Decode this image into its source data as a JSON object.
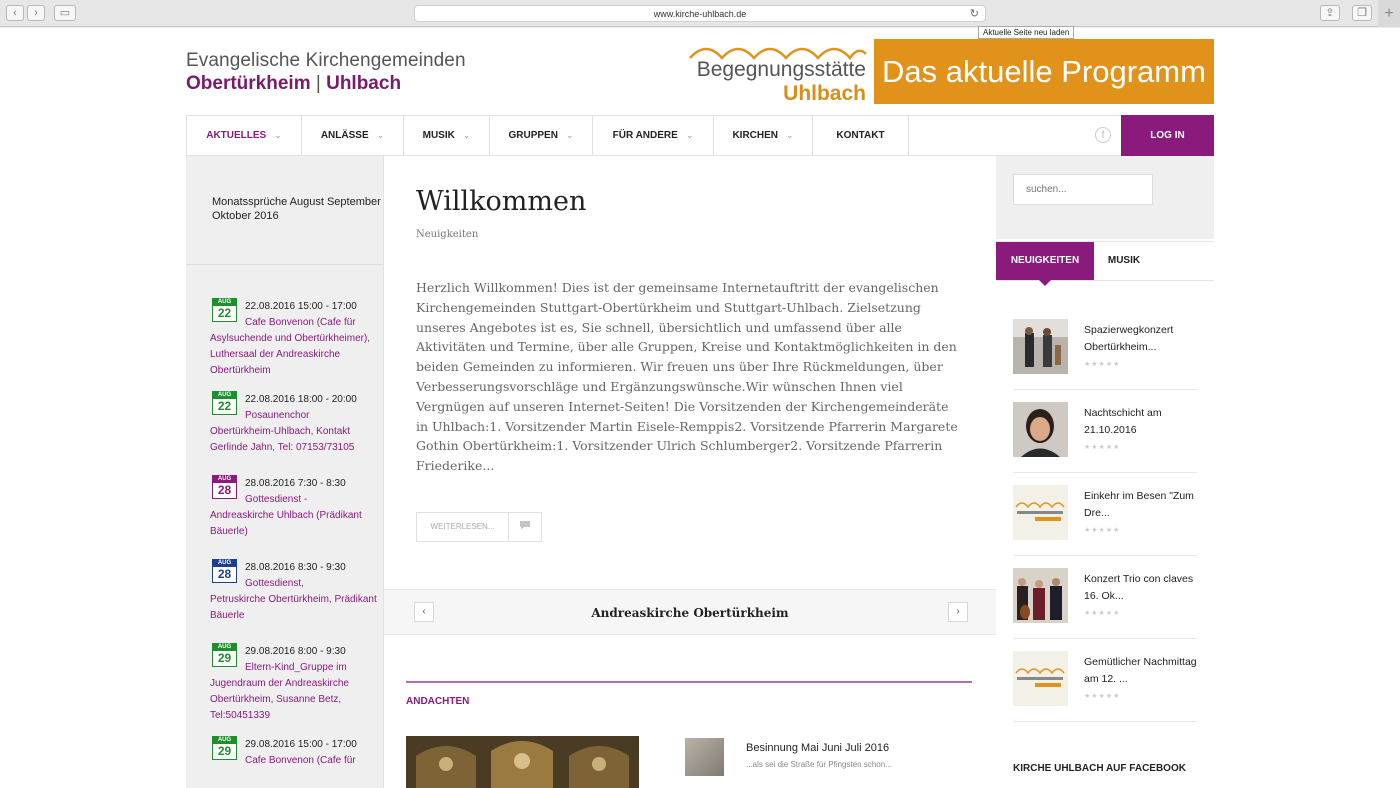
{
  "browser": {
    "url": "www.kirche-uhlbach.de",
    "tooltip": "Aktuelle Seite neu laden"
  },
  "brand": {
    "line1": "Evangelische Kirchengemeinden",
    "line2_a": "Obertürkheim",
    "line2_sep": "|",
    "line2_b": "Uhlbach"
  },
  "logo": {
    "word1": "Begegnungsstätte",
    "word2": "Uhlbach",
    "colors": {
      "orange": "#e1921b",
      "purple": "#8b1a7d"
    }
  },
  "banner": {
    "text": "Das aktuelle Programm"
  },
  "nav": {
    "items": [
      {
        "label": "AKTUELLES",
        "chevron": "⌄"
      },
      {
        "label": "ANLÄSSE",
        "chevron": "⌄"
      },
      {
        "label": "MUSIK",
        "chevron": "⌄"
      },
      {
        "label": "GRUPPEN",
        "chevron": "⌄"
      },
      {
        "label": "FÜR ANDERE",
        "chevron": "⌄"
      },
      {
        "label": "KIRCHEN",
        "chevron": "⌄"
      },
      {
        "label": "KONTAKT",
        "chevron": ""
      }
    ],
    "facebook_glyph": "f",
    "login": "LOG IN"
  },
  "left": {
    "heading": "Monatssprüche August September Oktober 2016",
    "events": [
      {
        "month": "AUG",
        "day": "22",
        "color": "#1f8f2e",
        "date": "22.08.2016 15:00 - 17:00",
        "title": "Cafe Bonvenon (Cafe für",
        "cont": "Asylsuchende und Obertürkheimer), Luthersaal der Andreaskirche Obertürkheim"
      },
      {
        "month": "AUG",
        "day": "22",
        "color": "#1f8f2e",
        "date": "22.08.2016 18:00 - 20:00",
        "title": "Posaunenchor",
        "cont": "Obertürkheim-Uhlbach, Kontakt Gerlinde Jahn, Tel: 07153/73105"
      },
      {
        "month": "AUG",
        "day": "28",
        "color": "#8b1a7d",
        "date": "28.08.2016 7:30 - 8:30",
        "title": "Gottesdienst -",
        "cont": "Andreaskirche Uhlbach (Prädikant Bäuerle)"
      },
      {
        "month": "AUG",
        "day": "28",
        "color": "#1c3f94",
        "date": "28.08.2016 8:30 - 9:30",
        "title": "Gottesdienst,",
        "cont": "Petruskirche Obertürkheim, Prädikant Bäuerle"
      },
      {
        "month": "AUG",
        "day": "29",
        "color": "#1f8f2e",
        "date": "29.08.2016 8:00 - 9:30",
        "title": "Eltern-Kind_Gruppe im",
        "cont": "Jugendraum der Andreaskirche Obertürkheim, Susanne Betz, Tel:50451339"
      },
      {
        "month": "AUG",
        "day": "29",
        "color": "#1f8f2e",
        "date": "29.08.2016 15:00 - 17:00",
        "title": "Cafe Bonvenon (Cafe für",
        "cont": ""
      }
    ]
  },
  "post": {
    "title": "Willkommen",
    "category": "Neuigkeiten",
    "body": "Herzlich Willkommen! Dies ist der gemeinsame Internetauftritt der evangelischen Kirchengemeinden Stuttgart-Obertürkheim und Stuttgart-Uhlbach. Zielsetzung unseres Angebotes ist es, Sie schnell, übersichtlich und umfassend über alle Aktivitäten und Termine, über alle Gruppen, Kreise und Kontaktmöglichkeiten in den beiden Gemeinden zu informieren. Wir freuen uns über Ihre Rückmeldungen, über Verbesserungsvorschläge und Ergänzungswünsche.Wir wünschen Ihnen viel Vergnügen auf unseren Internet-Seiten! Die Vorsitzenden der Kirchengemeinderäte in Uhlbach:1. Vorsitzender Martin Eisele-Remppis2. Vorsitzende Pfarrerin Margarete Gothin Obertürkheim:1. Vorsitzender Ulrich Schlumberger2. Vorsitzende Pfarrerin Friederike...",
    "more": "WEITERLESEN..."
  },
  "slider": {
    "title": "Andreaskirche Obertürkheim",
    "prev": "‹",
    "next": "›"
  },
  "andachten": {
    "heading": "ANDACHTEN",
    "item_title": "Besinnung Mai Juni Juli 2016",
    "item_excerpt": "...als sei die Straße für Pfingsten schon..."
  },
  "right": {
    "search_placeholder": "suchen...",
    "tabs": [
      "NEUIGKEITEN",
      "MUSIK"
    ],
    "news": [
      {
        "title": "Spazierwegkonzert Obertürkheim...",
        "thumb": "musicians"
      },
      {
        "title": "Nachtschicht am 21.10.2016",
        "thumb": "portrait"
      },
      {
        "title": "Einkehr im Besen \"Zum Dre...",
        "thumb": "logo"
      },
      {
        "title": "Konzert Trio con claves 16. Ok...",
        "thumb": "trio"
      },
      {
        "title": "Gemütlicher Nachmittag am 12. ...",
        "thumb": "logo"
      }
    ],
    "stars": "★★★★★",
    "facebook_heading": "KIRCHE UHLBACH AUF FACEBOOK"
  }
}
